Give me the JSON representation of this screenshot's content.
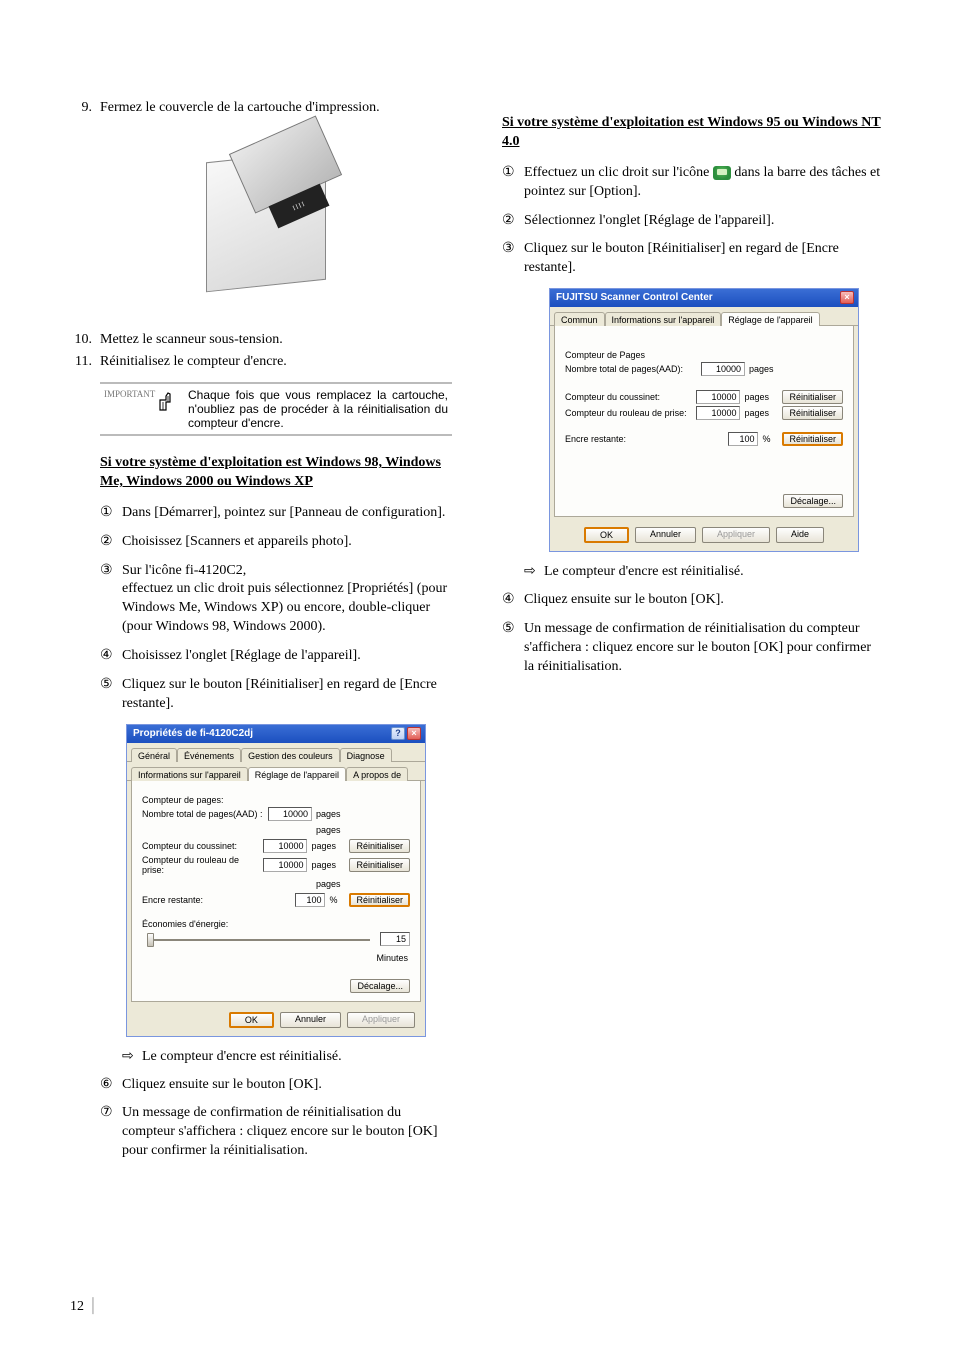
{
  "left": {
    "steps": [
      {
        "num": "9.",
        "text": "Fermez le couvercle de la cartouche d'impression."
      },
      {
        "num": "10.",
        "text": "Mettez le scanneur sous-tension."
      },
      {
        "num": "11.",
        "text": "Réinitialisez le compteur d'encre."
      }
    ],
    "scanner_slot_text": "IIII",
    "important": {
      "label": "IMPORTANT",
      "text": "Chaque fois que vous remplacez la cartouche, n'oubliez pas de procéder à la réinitialisation du compteur d'encre."
    },
    "heading": "Si votre système d'exploitation est Windows 98, Windows Me, Windows 2000 ou Windows XP",
    "items": [
      {
        "marker": "①",
        "text": "Dans [Démarrer], pointez sur [Panneau de configuration]."
      },
      {
        "marker": "②",
        "text": "Choisissez [Scanners et appareils photo]."
      },
      {
        "marker": "③",
        "text": "Sur l'icône fi-4120C2,\neffectuez un clic droit puis sélectionnez [Propriétés] (pour Windows Me, Windows XP) ou encore, double-cliquer (pour Windows 98, Windows 2000)."
      },
      {
        "marker": "④",
        "text": "Choisissez l'onglet [Réglage de l'appareil]."
      },
      {
        "marker": "⑤",
        "text": "Cliquez sur le bouton [Réinitialiser] en regard de [Encre restante]."
      }
    ],
    "dialog": {
      "title": "Propriétés de fi-4120C2dj",
      "tabs_row1": [
        "Général",
        "Événements",
        "Gestion des couleurs",
        "Diagnose"
      ],
      "tabs_row2": [
        "Informations sur l'appareil",
        "Réglage de l'appareil",
        "A propos de"
      ],
      "active_tab": "Réglage de l'appareil",
      "group1_label": "Compteur de pages:",
      "row1": {
        "label": "Nombre total de pages(AAD) :",
        "value": "10000",
        "unit": "pages"
      },
      "row_empty_unit": "pages",
      "row2": {
        "label": "Compteur du coussinet:",
        "value": "10000",
        "unit": "pages",
        "btn": "Réinitialiser"
      },
      "row3": {
        "label": "Compteur du rouleau de prise:",
        "value": "10000",
        "unit": "pages",
        "btn": "Réinitialiser"
      },
      "row_empty_unit2": "pages",
      "row4": {
        "label": "Encre restante:",
        "value": "100",
        "unit": "%",
        "btn": "Réinitialiser"
      },
      "group2_label": "Économies d'énergie:",
      "slider": {
        "value": "15",
        "unit": "Minutes"
      },
      "offset_btn": "Décalage...",
      "bottom": {
        "ok": "OK",
        "cancel": "Annuler",
        "apply": "Appliquer"
      }
    },
    "result": {
      "arrow": "⇨",
      "text": "Le compteur d'encre est réinitialisé."
    },
    "items2": [
      {
        "marker": "⑥",
        "text": "Cliquez ensuite sur le bouton [OK]."
      },
      {
        "marker": "⑦",
        "text": "Un message de confirmation de réinitialisation du compteur s'affichera : cliquez encore sur le bouton [OK] pour confirmer la réinitialisation."
      }
    ]
  },
  "right": {
    "heading": "Si votre système d'exploitation est Windows 95 ou Windows NT 4.0",
    "items": [
      {
        "marker": "①",
        "pre": "Effectuez un clic droit sur l'icône ",
        "post": " dans la barre des tâches et pointez sur [Option]."
      },
      {
        "marker": "②",
        "text": "Sélectionnez l'onglet [Réglage de l'appareil]."
      },
      {
        "marker": "③",
        "text": "Cliquez sur le bouton [Réinitialiser] en regard de [Encre restante]."
      }
    ],
    "dialog": {
      "title": "FUJITSU Scanner Control Center",
      "tabs": [
        "Commun",
        "Informations sur l'appareil",
        "Réglage de l'appareil"
      ],
      "active_tab": "Réglage de l'appareil",
      "group_label": "Compteur de Pages",
      "row1": {
        "label": "Nombre total de pages(AAD):",
        "value": "10000",
        "unit": "pages"
      },
      "row2": {
        "label": "Compteur du coussinet:",
        "value": "10000",
        "unit": "pages",
        "btn": "Réinitialiser"
      },
      "row3": {
        "label": "Compteur du rouleau de prise:",
        "value": "10000",
        "unit": "pages",
        "btn": "Réinitialiser"
      },
      "row4": {
        "label": "Encre restante:",
        "value": "100",
        "unit": "%",
        "btn": "Réinitialiser"
      },
      "offset_btn": "Décalage...",
      "bottom": {
        "ok": "OK",
        "cancel": "Annuler",
        "apply": "Appliquer",
        "help": "Aide"
      }
    },
    "result": {
      "arrow": "⇨",
      "text": "Le compteur d'encre est réinitialisé."
    },
    "items2": [
      {
        "marker": "④",
        "text": "Cliquez ensuite sur le bouton [OK]."
      },
      {
        "marker": "⑤",
        "text": "Un message de confirmation de réinitialisation du compteur s'affichera : cliquez encore sur le bouton [OK] pour confirmer la réinitialisation."
      }
    ]
  },
  "page_number": "12"
}
